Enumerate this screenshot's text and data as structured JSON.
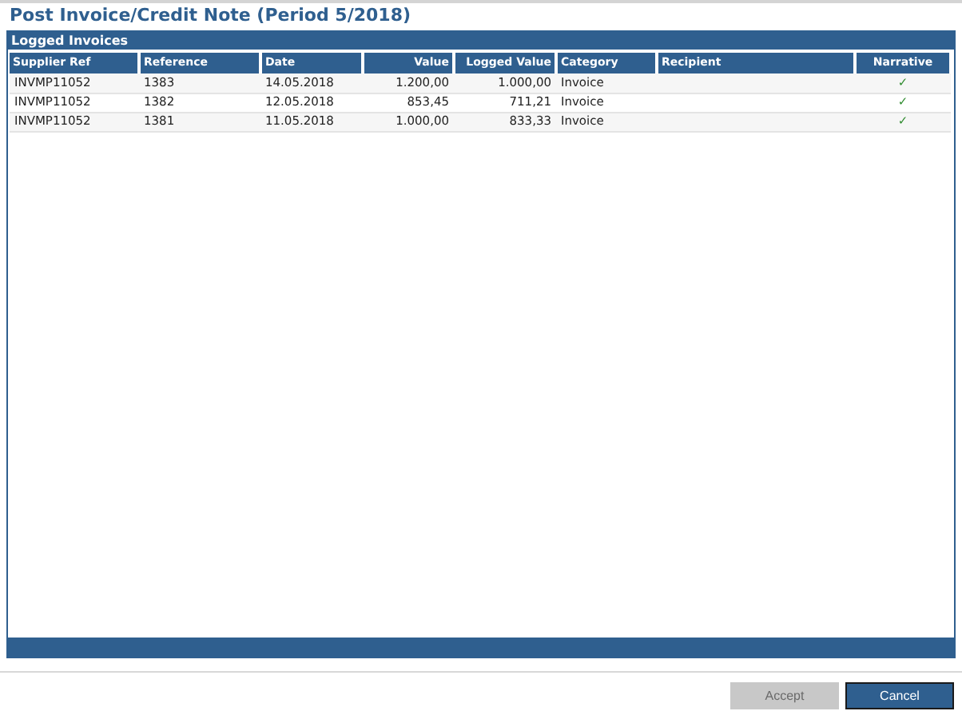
{
  "window": {
    "title": "Post Invoice/Credit Note (Period 5/2018)"
  },
  "panel": {
    "title": "Logged Invoices"
  },
  "table": {
    "columns": [
      {
        "label": "Supplier Ref",
        "kind": "text"
      },
      {
        "label": "Reference",
        "kind": "text"
      },
      {
        "label": "Date",
        "kind": "text"
      },
      {
        "label": "Value",
        "kind": "number"
      },
      {
        "label": "Logged Value",
        "kind": "number"
      },
      {
        "label": "Category",
        "kind": "text"
      },
      {
        "label": "Recipient",
        "kind": "text"
      },
      {
        "label": "Narrative",
        "kind": "check"
      }
    ],
    "rows": [
      {
        "cells": [
          "INVMP11052",
          "1383",
          "14.05.2018",
          "1.200,00",
          "1.000,00",
          "Invoice",
          "",
          "✓"
        ]
      },
      {
        "cells": [
          "INVMP11052",
          "1382",
          "12.05.2018",
          "853,45",
          "711,21",
          "Invoice",
          "",
          "✓"
        ]
      },
      {
        "cells": [
          "INVMP11052",
          "1381",
          "11.05.2018",
          "1.000,00",
          "833,33",
          "Invoice",
          "",
          "✓"
        ]
      }
    ]
  },
  "buttons": [
    {
      "label": "Accept",
      "disabled": true
    },
    {
      "label": "Cancel",
      "disabled": false
    }
  ]
}
